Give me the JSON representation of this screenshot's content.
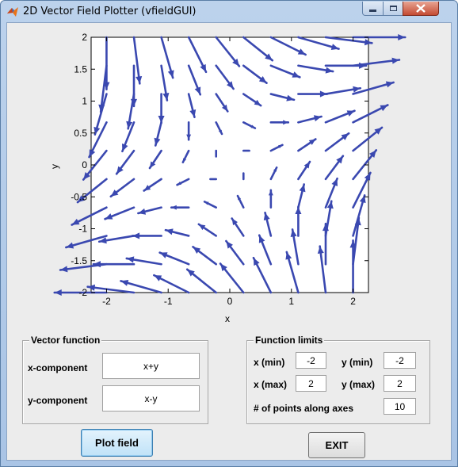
{
  "window": {
    "title": "2D Vector Field Plotter (vfieldGUI)"
  },
  "chart_data": {
    "type": "quiver",
    "function": {
      "u": "x+y",
      "v": "x-y"
    },
    "xlim": [
      -2.25,
      2.25
    ],
    "ylim": [
      -2,
      2
    ],
    "grid": false,
    "xlabel": "x",
    "ylabel": "y",
    "x_ticks": [
      "-2",
      "-1",
      "0",
      "1",
      "2"
    ],
    "y_ticks": [
      "-2",
      "-1.5",
      "-1",
      "-0.5",
      "0",
      "0.5",
      "1",
      "1.5",
      "2"
    ],
    "points_per_axis": 10,
    "domain": {
      "xmin": -2,
      "xmax": 2,
      "ymin": -2,
      "ymax": 2
    },
    "arrow_color": "#3a48b0"
  },
  "vector_panel": {
    "title": "Vector function",
    "x_label": "x-component",
    "x_value": "x+y",
    "y_label": "y-component",
    "y_value": "x-y"
  },
  "limits_panel": {
    "title": "Function limits",
    "xmin_label": "x (min)",
    "xmin_value": "-2",
    "ymin_label": "y (min)",
    "ymin_value": "-2",
    "xmax_label": "x (max)",
    "xmax_value": "2",
    "ymax_label": "y (max)",
    "ymax_value": "2",
    "points_label": "# of points along axes",
    "points_value": "10"
  },
  "buttons": {
    "plot": "Plot field",
    "exit": "EXIT"
  }
}
